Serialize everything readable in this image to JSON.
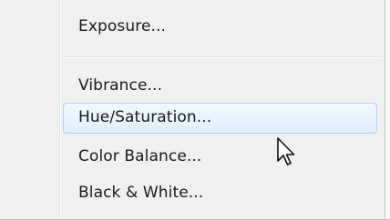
{
  "menu": {
    "items": [
      {
        "label": "Exposure..."
      },
      {
        "label": "Vibrance..."
      },
      {
        "label": "Hue/Saturation..."
      },
      {
        "label": "Color Balance..."
      },
      {
        "label": "Black & White..."
      }
    ],
    "hovered_item": "Hue/Saturation...",
    "colors": {
      "background": "#f0f0f0",
      "hover_border": "#aecff7",
      "hover_fill": "#e1edfb",
      "text": "#1a1a1a"
    }
  },
  "cursor": {
    "icon": "arrow-pointer-icon"
  }
}
